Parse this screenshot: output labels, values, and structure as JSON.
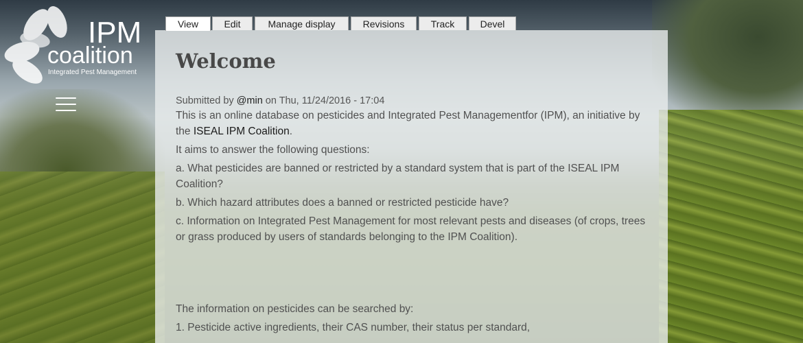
{
  "site": {
    "logo_title_line1": "IPM",
    "logo_title_line2": "coalition",
    "logo_tagline": "Integrated Pest Management"
  },
  "tabs": [
    {
      "label": "View",
      "active": true
    },
    {
      "label": "Edit",
      "active": false
    },
    {
      "label": "Manage display",
      "active": false
    },
    {
      "label": "Revisions",
      "active": false
    },
    {
      "label": "Track",
      "active": false
    },
    {
      "label": "Devel",
      "active": false
    }
  ],
  "page": {
    "title": "Welcome",
    "submitted_prefix": "Submitted by",
    "author": "@min",
    "submitted_on": "on Thu, 11/24/2016 - 17:04",
    "intro_before_link": "This is an online database on pesticides and Integrated Pest Managementfor (IPM), an initiative by the",
    "intro_link": "ISEAL IPM Coalition",
    "intro_after_link": ".",
    "aims": "It aims to answer the following questions:",
    "question_a": "a. What pesticides are banned or restricted by a standard system that is part of the ISEAL IPM Coalition?",
    "question_b": "b. Which hazard attributes does a banned or restricted pesticide have?",
    "question_c": "c. Information on Integrated Pest Management for most relevant pests and diseases (of crops, trees or grass produced by users of standards belonging to the IPM Coalition).",
    "search_intro": "The information on pesticides can be searched by:",
    "search_item_1": "1. Pesticide active ingredients, their CAS number, their status per standard,"
  },
  "colors": {
    "panel_bg": "#e8ecec",
    "text": "#505050",
    "title": "#484848",
    "tab_bg": "#ececec",
    "tab_active_bg": "#ffffff"
  },
  "icons": {
    "menu": "hamburger-menu-icon",
    "logo_mark": "leaf-petals-icon"
  }
}
